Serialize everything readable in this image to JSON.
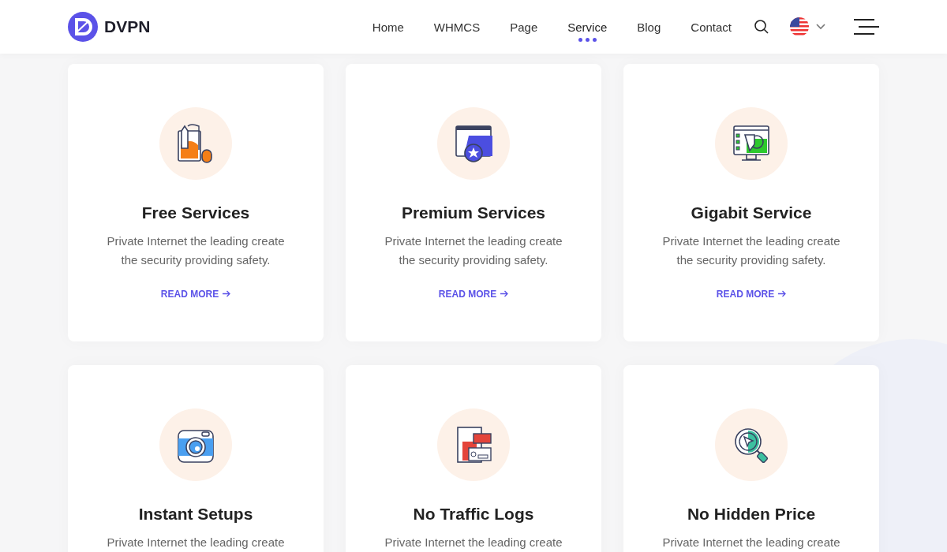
{
  "brand": "DVPN",
  "nav": [
    {
      "label": "Home",
      "selected": false
    },
    {
      "label": "WHMCS",
      "selected": false
    },
    {
      "label": "Page",
      "selected": false
    },
    {
      "label": "Service",
      "selected": true
    },
    {
      "label": "Blog",
      "selected": false
    },
    {
      "label": "Contact",
      "selected": false
    }
  ],
  "services": [
    {
      "title": "Free Services",
      "description": "Private Internet the leading create the security providing safety.",
      "link": "READ MORE"
    },
    {
      "title": "Premium Services",
      "description": "Private Internet the leading create the security providing safety.",
      "link": "READ MORE"
    },
    {
      "title": "Gigabit Service",
      "description": "Private Internet the leading create the security providing safety.",
      "link": "READ MORE"
    },
    {
      "title": "Instant Setups",
      "description": "Private Internet the leading create"
    },
    {
      "title": "No Traffic Logs",
      "description": "Private Internet the leading create"
    },
    {
      "title": "No Hidden Price",
      "description": "Private Internet the leading create"
    }
  ]
}
